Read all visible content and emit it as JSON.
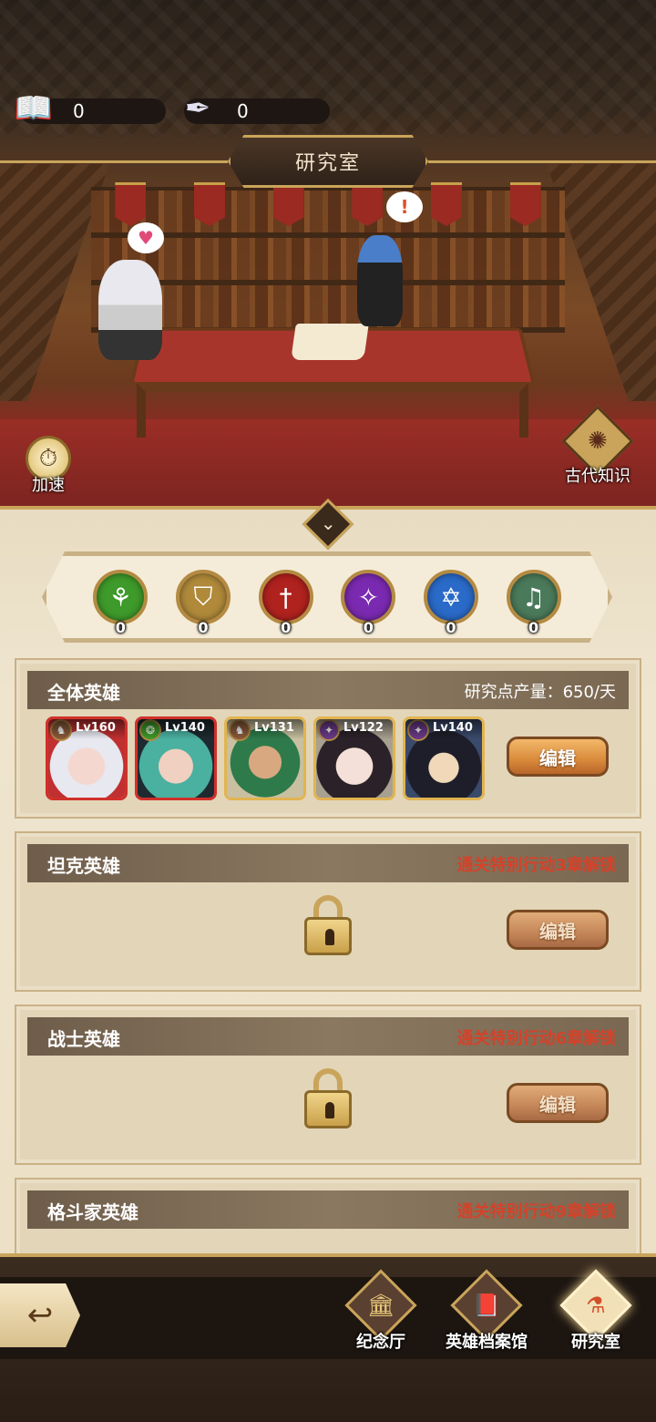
{
  "resources": [
    {
      "icon": "book-icon",
      "value": "0"
    },
    {
      "icon": "quill-icon",
      "value": "0"
    }
  ],
  "title": "研究室",
  "side_buttons": {
    "speed_label": "加速",
    "ancient_label": "古代知识"
  },
  "factions": [
    {
      "icon": "nature-faction-icon",
      "count": "0",
      "color": "#3e9a2a",
      "glyph": "⚘"
    },
    {
      "icon": "shield-faction-icon",
      "count": "0",
      "color": "#b08a3a",
      "glyph": "⛉"
    },
    {
      "icon": "sword-faction-icon",
      "count": "0",
      "color": "#b0221e",
      "glyph": "†"
    },
    {
      "icon": "arcane-faction-icon",
      "count": "0",
      "color": "#7a2ab0",
      "glyph": "✧"
    },
    {
      "icon": "star-faction-icon",
      "count": "0",
      "color": "#2a6ac8",
      "glyph": "✡"
    },
    {
      "icon": "lyre-faction-icon",
      "count": "0",
      "color": "#4a7a5a",
      "glyph": "♫"
    }
  ],
  "sections": [
    {
      "title": "全体英雄",
      "right_text": "研究点产量：650/天",
      "edit_label": "编辑",
      "heroes": [
        {
          "level": "Lv160",
          "frame": "red",
          "faction_icon": "beast-faction-icon"
        },
        {
          "level": "Lv140",
          "frame": "red",
          "faction_icon": "nature-faction-icon"
        },
        {
          "level": "Lv131",
          "frame": "gold",
          "faction_icon": "beast-faction-icon"
        },
        {
          "level": "Lv122",
          "frame": "gold",
          "faction_icon": "dragon-faction-icon"
        },
        {
          "level": "Lv140",
          "frame": "gold",
          "faction_icon": "dragon-faction-icon"
        }
      ]
    },
    {
      "title": "坦克英雄",
      "right_text": "通关特别行动3章解锁",
      "edit_label": "编辑"
    },
    {
      "title": "战士英雄",
      "right_text": "通关特别行动6章解锁",
      "edit_label": "编辑"
    },
    {
      "title": "格斗家英雄",
      "right_text": "通关特别行动9章解锁"
    }
  ],
  "nav": [
    {
      "label": "纪念厅",
      "icon": "memorial-hall-icon",
      "active": false
    },
    {
      "label": "英雄档案馆",
      "icon": "hero-archive-icon",
      "active": false
    },
    {
      "label": "研究室",
      "icon": "laboratory-icon",
      "active": true
    }
  ]
}
